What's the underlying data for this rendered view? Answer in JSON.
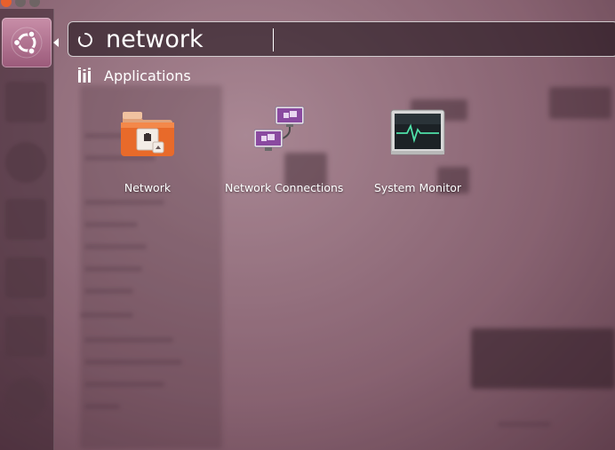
{
  "search": {
    "query": "network"
  },
  "category": {
    "label": "Applications",
    "icon": "applications-category-icon"
  },
  "results": [
    {
      "label": "Network",
      "icon": "network-folder-icon"
    },
    {
      "label": "Network Connections",
      "icon": "network-connections-icon"
    },
    {
      "label": "System Monitor",
      "icon": "system-monitor-icon"
    }
  ],
  "colors": {
    "accent": "#e8602c",
    "launcher_bfb": "#b07090"
  }
}
